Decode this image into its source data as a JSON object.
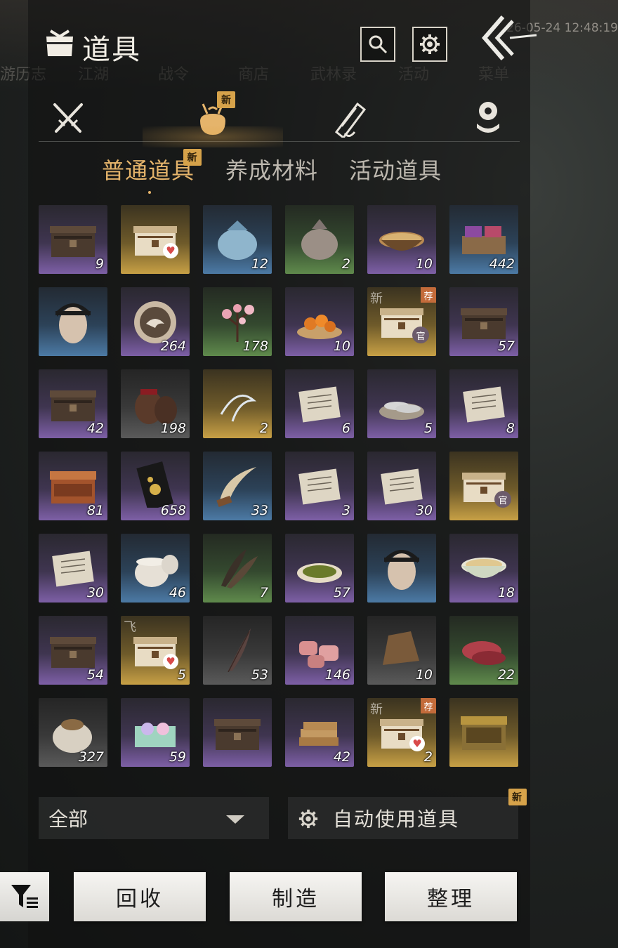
{
  "header": {
    "title": "道具",
    "timestamp": "26-05-24 12:48:19",
    "bg_menu": [
      "游历志",
      "江湖",
      "战令",
      "商店",
      "武林录",
      "活动",
      "菜单"
    ]
  },
  "categories": [
    {
      "icon": "crossed-swords-icon",
      "active": false,
      "new": false
    },
    {
      "icon": "bag-icon",
      "active": true,
      "new": true
    },
    {
      "icon": "scroll-icon",
      "active": false,
      "new": false
    },
    {
      "icon": "token-icon",
      "active": false,
      "new": false
    }
  ],
  "new_badge": "新",
  "subtabs": [
    {
      "label": "普通道具",
      "active": true
    },
    {
      "label": "养成材料",
      "active": false
    },
    {
      "label": "活动道具",
      "active": false
    }
  ],
  "items": [
    {
      "art": "chest-dark",
      "rarity": "purple",
      "count": "9"
    },
    {
      "art": "chest-gold",
      "rarity": "gold",
      "count": "",
      "heart": true
    },
    {
      "art": "silk-pouch",
      "rarity": "blue",
      "count": "12"
    },
    {
      "art": "cloth-sack",
      "rarity": "green",
      "count": "2"
    },
    {
      "art": "soup-bowl",
      "rarity": "purple",
      "count": "10"
    },
    {
      "art": "dye-box",
      "rarity": "blue",
      "count": "442"
    },
    {
      "art": "portrait",
      "rarity": "blue",
      "count": ""
    },
    {
      "art": "dove-coin",
      "rarity": "purple",
      "count": "264"
    },
    {
      "art": "blossom",
      "rarity": "green",
      "count": "178"
    },
    {
      "art": "fruit-plate",
      "rarity": "purple",
      "count": "10"
    },
    {
      "art": "chest-gold",
      "rarity": "gold",
      "count": "",
      "corner": "新",
      "rec": "荐",
      "offi": "官"
    },
    {
      "art": "chest-dark",
      "rarity": "purple",
      "count": "57"
    },
    {
      "art": "chest-dark",
      "rarity": "purple",
      "count": "42"
    },
    {
      "art": "wine-jars",
      "rarity": "gray",
      "count": "198"
    },
    {
      "art": "wisp",
      "rarity": "gold",
      "count": "2"
    },
    {
      "art": "paper",
      "rarity": "purple",
      "count": "6"
    },
    {
      "art": "fish-plate",
      "rarity": "purple",
      "count": "5"
    },
    {
      "art": "paper",
      "rarity": "purple",
      "count": "8"
    },
    {
      "art": "chest-red",
      "rarity": "purple",
      "count": "81"
    },
    {
      "art": "talisman",
      "rarity": "purple",
      "count": "658"
    },
    {
      "art": "horn",
      "rarity": "blue",
      "count": "33"
    },
    {
      "art": "paper",
      "rarity": "purple",
      "count": "3"
    },
    {
      "art": "paper",
      "rarity": "purple",
      "count": "30"
    },
    {
      "art": "chest-gold",
      "rarity": "gold",
      "count": "",
      "offi": "官"
    },
    {
      "art": "paper",
      "rarity": "purple",
      "count": "30"
    },
    {
      "art": "porcelain-jar",
      "rarity": "blue",
      "count": "46"
    },
    {
      "art": "feathers",
      "rarity": "green",
      "count": "7"
    },
    {
      "art": "herb-plate",
      "rarity": "purple",
      "count": "57"
    },
    {
      "art": "portrait",
      "rarity": "blue",
      "count": ""
    },
    {
      "art": "dumpling-bowl",
      "rarity": "purple",
      "count": "18"
    },
    {
      "art": "chest-dark",
      "rarity": "purple",
      "count": "54"
    },
    {
      "art": "chest-gold",
      "rarity": "gold",
      "count": "5",
      "corner": "飞",
      "heart": true
    },
    {
      "art": "feather",
      "rarity": "gray",
      "count": "53"
    },
    {
      "art": "meat",
      "rarity": "purple",
      "count": "146"
    },
    {
      "art": "pelt",
      "rarity": "gray",
      "count": "10"
    },
    {
      "art": "steak",
      "rarity": "green",
      "count": "22"
    },
    {
      "art": "grain-sack",
      "rarity": "gray",
      "count": "327"
    },
    {
      "art": "gem-box",
      "rarity": "purple",
      "count": "59"
    },
    {
      "art": "chest-dark",
      "rarity": "purple",
      "count": ""
    },
    {
      "art": "cakes",
      "rarity": "purple",
      "count": "42"
    },
    {
      "art": "chest-gold",
      "rarity": "gold",
      "count": "2",
      "corner": "新",
      "rec": "荐",
      "heart": true
    },
    {
      "art": "chest-ornate",
      "rarity": "gold",
      "count": ""
    }
  ],
  "filter": {
    "dropdown_value": "全部",
    "auto_use_label": "自动使用道具"
  },
  "actions": {
    "recycle": "回收",
    "craft": "制造",
    "sort": "整理"
  },
  "colors": {
    "accent": "#e5b46b",
    "badge": "#d6a24a"
  }
}
